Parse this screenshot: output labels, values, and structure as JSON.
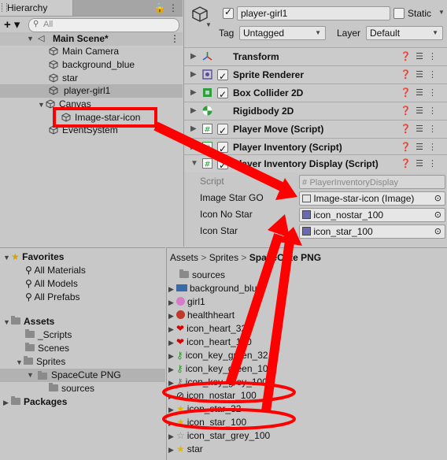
{
  "hierarchy": {
    "tab_label": "Hierarchy",
    "add_label": "+ ▾",
    "search_placeholder": "All",
    "scene": "Main Scene*",
    "items": [
      {
        "label": "Main Camera"
      },
      {
        "label": "background_blue"
      },
      {
        "label": "star"
      },
      {
        "label": "player-girl1"
      },
      {
        "label": "Canvas"
      },
      {
        "label": "Image-star-icon"
      },
      {
        "label": "EventSystem"
      }
    ]
  },
  "inspector": {
    "object_name": "player-girl1",
    "static_label": "Static",
    "tag_label": "Tag",
    "tag_value": "Untagged",
    "layer_label": "Layer",
    "layer_value": "Default",
    "components": [
      {
        "title": "Transform"
      },
      {
        "title": "Sprite Renderer"
      },
      {
        "title": "Box Collider 2D"
      },
      {
        "title": "Rigidbody 2D"
      },
      {
        "title": "Player Move (Script)"
      },
      {
        "title": "Player Inventory (Script)"
      },
      {
        "title": "Player Inventory Display (Script)"
      }
    ],
    "props": [
      {
        "label": "Script",
        "value": "PlayerInventoryDisplay"
      },
      {
        "label": "Image Star GO",
        "value": "Image-star-icon (Image)"
      },
      {
        "label": "Icon No Star",
        "value": "icon_nostar_100"
      },
      {
        "label": "Icon Star",
        "value": "icon_star_100"
      }
    ]
  },
  "project": {
    "favorites_label": "Favorites",
    "favorites": [
      "All Materials",
      "All Models",
      "All Prefabs"
    ],
    "assets_label": "Assets",
    "tree": [
      "_Scripts",
      "Scenes",
      "Sprites",
      "SpaceCute PNG",
      "sources"
    ],
    "packages_label": "Packages",
    "breadcrumb": [
      "Assets",
      "Sprites",
      "SpaceCute PNG"
    ],
    "files": [
      "sources",
      "background_blue",
      "girl1",
      "healthheart",
      "icon_heart_32",
      "icon_heart_100",
      "icon_key_green_32",
      "icon_key_green_100",
      "icon_key_grey_100",
      "icon_nostar_100",
      "icon_star_32",
      "icon_star_100",
      "icon_star_grey_100",
      "star"
    ]
  },
  "colors": {
    "annotation": "#ff0000",
    "selection": "#b2b2b2",
    "panel": "#c8c8c8"
  }
}
